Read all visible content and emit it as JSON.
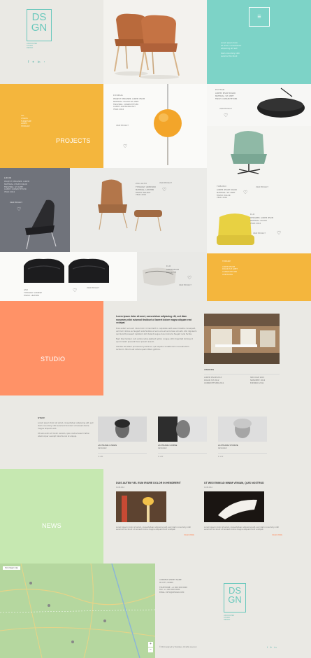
{
  "brand": {
    "logo_letters": [
      "DS",
      "GN"
    ],
    "tagline": [
      "ASSOCIATES",
      "STUDIO",
      "DESIGN"
    ],
    "social_icons": [
      "facebook-icon",
      "twitter-icon",
      "linkedin-icon",
      "rss-icon"
    ]
  },
  "header": {
    "menu_box": "☰"
  },
  "colors": {
    "teal": "#7dd3c7",
    "mustard": "#f4b63d",
    "slate": "#70737b",
    "coral": "#ff9267",
    "mint": "#c6e8b1",
    "bg": "#eae9e4"
  },
  "sections": {
    "projects": "PROJECTS",
    "studio": "STUDIO",
    "news": "NEWS"
  },
  "products": {
    "fondue": {
      "name": "FONDUE",
      "link": "VIEW PROJECT"
    },
    "potter": {
      "name": "POTTER",
      "link": "VIEW PROJECT"
    },
    "tubuno": {
      "name": "TUBUNO",
      "link": "VIEW PROJECT"
    },
    "louis": {
      "name": "LOUIS",
      "link": "VIEW PROJECT"
    },
    "zigi": {
      "name": "ZIGI-ALTO",
      "link": "VIEW PROJECT"
    },
    "flo": {
      "name": "FLO",
      "link": "VIEW PROJECT"
    },
    "flo2": {
      "name": "FLO",
      "link": "VIEW PROJECT"
    },
    "ami": {
      "name": "AMI",
      "link": "VIEW PROJECT"
    }
  },
  "studio": {
    "lead": "Lorem ipsum dolor sit amet, consectetuer adipiscing elit, sed diam nonummy nibh euismod tincidunt ut laoreet dolore magna aliquam erat volutpat.",
    "awards_title": "AWARDS"
  },
  "team": {
    "title": "STAFF",
    "members": [
      {
        "name": "LASTNAME LINDEN",
        "role": "DESIGNER"
      },
      {
        "name": "LASTNAME GOMME",
        "role": "DESIGNER"
      },
      {
        "name": "LASTNAME STORME",
        "role": "DESIGNER"
      }
    ]
  },
  "news": {
    "items": [
      {
        "title": "DUIS AUTEM VEL EUM IRIURE DOLOR IN HENDRERIT",
        "more": "READ MORE"
      },
      {
        "title": "UT WISI ENIM AD MINIM VENIAM, QUIS NOSTRUD",
        "more": "READ MORE"
      }
    ]
  },
  "contact": {
    "lines": [
      "ADDRESS STREET NAME",
      "00 CITY, 00000",
      "TELEPHONE: +1 000 000 0000",
      "FAX: +1 000 000 0000",
      "EMAIL: INFO@DESIGN.COM"
    ]
  },
  "footer": {
    "copyright": "© 2014 designed by Templates. All rights reserved."
  }
}
